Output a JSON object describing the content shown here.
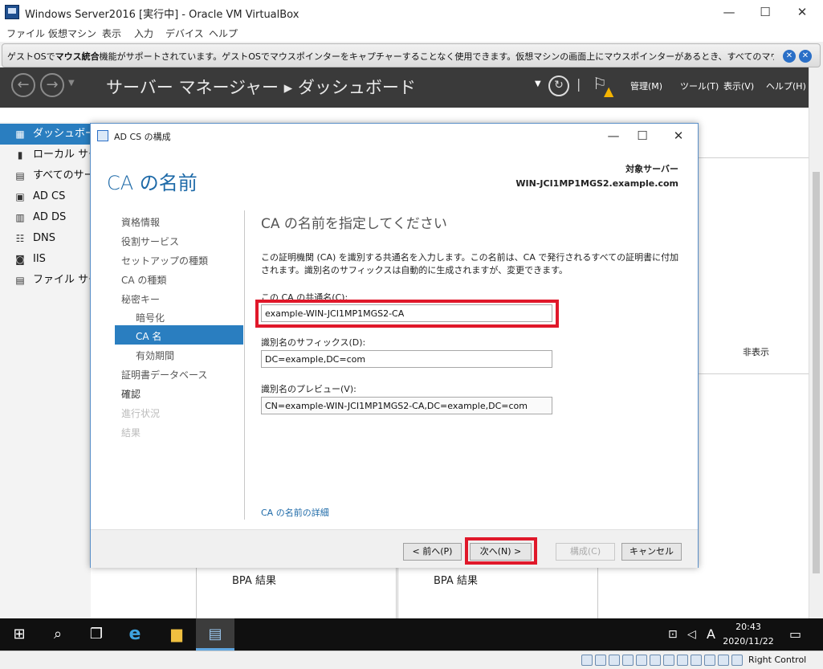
{
  "vbox": {
    "title": "Windows Server2016 [実行中] - Oracle VM VirtualBox",
    "menu": [
      "ファイル",
      "仮想マシン",
      "表示",
      "入力",
      "デバイス",
      "ヘルプ"
    ],
    "notice_pre": "ゲストOSで",
    "notice_bold": "マウス統合",
    "notice_post": "機能がサポートされています。ゲストOSでマウスポインターをキャプチャーすることなく使用できます。仮想マシンの画面上にマウスポインターがあるとき、すべてのマウスの動作は直接ゲスト",
    "status_host_key": "Right Control"
  },
  "server_manager": {
    "title": "サーバー マネージャー ▸ ダッシュボード",
    "menu": {
      "manage": "管理(M)",
      "tools": "ツール(T)",
      "view": "表示(V)",
      "help": "ヘルプ(H)"
    },
    "sidebar": [
      {
        "label": "ダッシュボード",
        "icon": "dashboard-icon",
        "glyph": "▦"
      },
      {
        "label": "ローカル サーバー",
        "icon": "server-icon",
        "glyph": "▮"
      },
      {
        "label": "すべてのサーバー",
        "icon": "servers-icon",
        "glyph": "▤"
      },
      {
        "label": "AD CS",
        "icon": "certificate-icon",
        "glyph": "▣"
      },
      {
        "label": "AD DS",
        "icon": "directory-icon",
        "glyph": "▥"
      },
      {
        "label": "DNS",
        "icon": "dns-icon",
        "glyph": "☷"
      },
      {
        "label": "IIS",
        "icon": "iis-icon",
        "glyph": "◙"
      },
      {
        "label": "ファイル サービス",
        "icon": "file-services-icon",
        "glyph": "▤"
      }
    ],
    "hide_label": "非表示",
    "bpa_label": "BPA 結果"
  },
  "dialog": {
    "title": "AD CS の構成",
    "heading": "CA の名前",
    "target_label": "対象サーバー",
    "target_value": "WIN-JCI1MP1MGS2.example.com",
    "nav": [
      {
        "label": "資格情報",
        "state": "normal"
      },
      {
        "label": "役割サービス",
        "state": "normal"
      },
      {
        "label": "セットアップの種類",
        "state": "normal"
      },
      {
        "label": "CA の種類",
        "state": "normal"
      },
      {
        "label": "秘密キー",
        "state": "normal"
      },
      {
        "label": "暗号化",
        "state": "sub"
      },
      {
        "label": "CA 名",
        "state": "active"
      },
      {
        "label": "有効期間",
        "state": "sub"
      },
      {
        "label": "証明書データベース",
        "state": "normal"
      },
      {
        "label": "確認",
        "state": "bold"
      },
      {
        "label": "進行状況",
        "state": "disabled"
      },
      {
        "label": "結果",
        "state": "disabled"
      }
    ],
    "content_title": "CA の名前を指定してください",
    "description": "この証明機関 (CA) を識別する共通名を入力します。この名前は、CA で発行されるすべての証明書に付加されます。識別名のサフィックスは自動的に生成されますが、変更できます。",
    "common_name_label": "この CA の共通名(C):",
    "common_name_value": "example-WIN-JCI1MP1MGS2-CA",
    "suffix_label": "識別名のサフィックス(D):",
    "suffix_value": "DC=example,DC=com",
    "preview_label": "識別名のプレビュー(V):",
    "preview_value": "CN=example-WIN-JCI1MP1MGS2-CA,DC=example,DC=com",
    "more_link": "CA の名前の詳細",
    "buttons": {
      "prev": "< 前へ(P)",
      "next": "次へ(N) >",
      "configure": "構成(C)",
      "cancel": "キャンセル"
    }
  },
  "taskbar": {
    "time": "20:43",
    "date": "2020/11/22",
    "ime": "A"
  },
  "colors": {
    "accent": "#2a7ec0",
    "highlight": "#e0182a",
    "heading": "#1e6aa8"
  }
}
